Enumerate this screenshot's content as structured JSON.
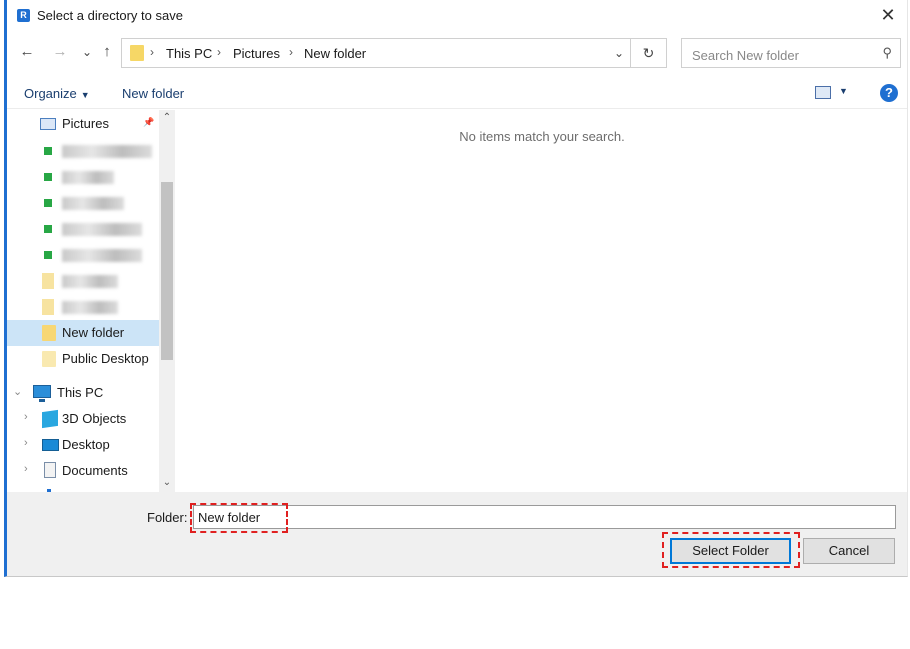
{
  "window": {
    "app_icon_letter": "R",
    "title": "Select a directory to save",
    "close_glyph": "✕"
  },
  "navbar": {
    "back_glyph": "←",
    "forward_glyph": "→",
    "recent_glyph": "⌄",
    "up_glyph": "↑",
    "breadcrumbs": [
      "This PC",
      "Pictures",
      "New folder"
    ],
    "separator": "›",
    "address_dropdown_glyph": "⌄",
    "refresh_glyph": "↻",
    "search_placeholder": "Search New folder",
    "search_glyph": "⚲"
  },
  "toolbar": {
    "organize_label": "Organize",
    "organize_caret": "▼",
    "new_folder_label": "New folder",
    "view_caret": "▼",
    "help_glyph": "?"
  },
  "nav_pane": {
    "pinned": {
      "label": "Pictures",
      "pin_glyph": "📌"
    },
    "items": [
      {
        "label": "New folder",
        "selected": true
      },
      {
        "label": "Public Desktop",
        "selected": false
      }
    ],
    "this_pc": {
      "label": "This PC",
      "expand_glyph": "⌄"
    },
    "this_pc_children": [
      {
        "label": "3D Objects",
        "expand_glyph": "›"
      },
      {
        "label": "Desktop",
        "expand_glyph": "›"
      },
      {
        "label": "Documents",
        "expand_glyph": "›"
      }
    ],
    "scroll_up_glyph": "⌃",
    "scroll_down_glyph": "⌄"
  },
  "content": {
    "empty_message": "No items match your search."
  },
  "footer": {
    "folder_label": "Folder:",
    "folder_value": "New folder",
    "select_button": "Select Folder",
    "cancel_button": "Cancel"
  },
  "colors": {
    "accent": "#1f6fd1",
    "highlight": "#e02020",
    "selection": "#cce4f7"
  }
}
